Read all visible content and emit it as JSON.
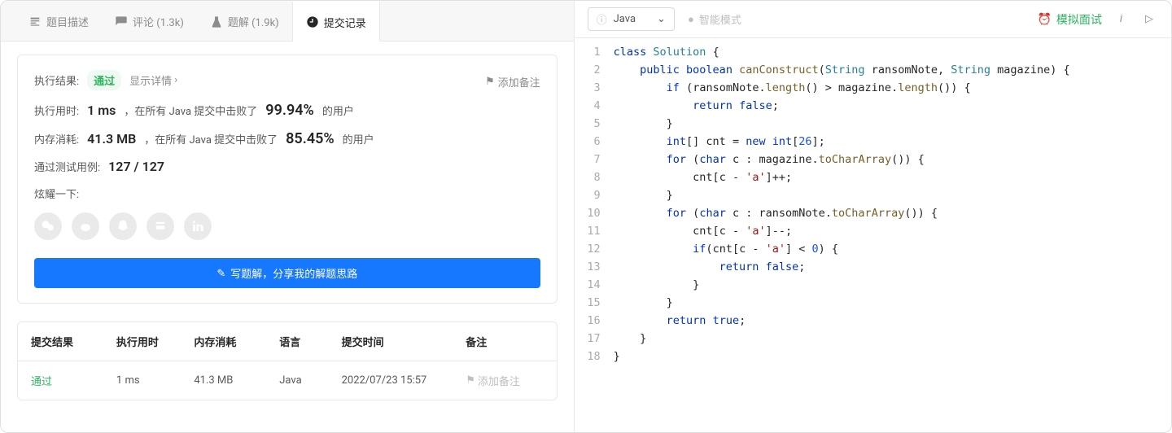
{
  "tabs": {
    "description": "题目描述",
    "comments": "评论 (1.3k)",
    "solutions": "题解 (1.9k)",
    "submissions": "提交记录"
  },
  "result": {
    "exec_label": "执行结果:",
    "status": "通过",
    "show_detail": "显示详情",
    "add_note": "添加备注",
    "runtime_label": "执行用时:",
    "runtime_value": "1 ms",
    "runtime_desc_prefix": "，在所有 Java 提交中击败了",
    "runtime_pct": "99.94%",
    "runtime_desc_suffix": "的用户",
    "memory_label": "内存消耗:",
    "memory_value": "41.3 MB",
    "memory_desc_prefix": "，在所有 Java 提交中击败了",
    "memory_pct": "85.45%",
    "memory_desc_suffix": "的用户",
    "testcases_label": "通过测试用例:",
    "testcases_value": "127 / 127",
    "share_label": "炫耀一下:",
    "write_solution": "写题解，分享我的解题思路"
  },
  "submissions_table": {
    "headers": {
      "result": "提交结果",
      "runtime": "执行用时",
      "memory": "内存消耗",
      "language": "语言",
      "time": "提交时间",
      "note": "备注"
    },
    "rows": [
      {
        "result": "通过",
        "runtime": "1 ms",
        "memory": "41.3 MB",
        "language": "Java",
        "time": "2022/07/23 15:57",
        "note": "添加备注"
      }
    ]
  },
  "editor_toolbar": {
    "language": "Java",
    "mode": "智能模式",
    "mock_interview": "模拟面试"
  },
  "code": {
    "lines": [
      [
        [
          "kw",
          "class"
        ],
        [
          "sp",
          " "
        ],
        [
          "type",
          "Solution"
        ],
        [
          "sp",
          " "
        ],
        [
          "punct",
          "{"
        ]
      ],
      [
        [
          "sp",
          "    "
        ],
        [
          "kw",
          "public"
        ],
        [
          "sp",
          " "
        ],
        [
          "kw",
          "boolean"
        ],
        [
          "sp",
          " "
        ],
        [
          "fn",
          "canConstruct"
        ],
        [
          "punct",
          "("
        ],
        [
          "type",
          "String"
        ],
        [
          "sp",
          " "
        ],
        [
          "ident",
          "ransomNote"
        ],
        [
          "punct",
          ", "
        ],
        [
          "type",
          "String"
        ],
        [
          "sp",
          " "
        ],
        [
          "ident",
          "magazine"
        ],
        [
          "punct",
          ") {"
        ]
      ],
      [
        [
          "sp",
          "        "
        ],
        [
          "kw",
          "if"
        ],
        [
          "sp",
          " "
        ],
        [
          "punct",
          "("
        ],
        [
          "ident",
          "ransomNote"
        ],
        [
          "punct",
          "."
        ],
        [
          "fn",
          "length"
        ],
        [
          "punct",
          "() > "
        ],
        [
          "ident",
          "magazine"
        ],
        [
          "punct",
          "."
        ],
        [
          "fn",
          "length"
        ],
        [
          "punct",
          "()) {"
        ]
      ],
      [
        [
          "sp",
          "            "
        ],
        [
          "kw",
          "return"
        ],
        [
          "sp",
          " "
        ],
        [
          "kw",
          "false"
        ],
        [
          "punct",
          ";"
        ]
      ],
      [
        [
          "sp",
          "        "
        ],
        [
          "punct",
          "}"
        ]
      ],
      [
        [
          "sp",
          "        "
        ],
        [
          "kw",
          "int"
        ],
        [
          "punct",
          "[] "
        ],
        [
          "ident",
          "cnt"
        ],
        [
          "punct",
          " = "
        ],
        [
          "kw",
          "new"
        ],
        [
          "sp",
          " "
        ],
        [
          "kw",
          "int"
        ],
        [
          "punct",
          "["
        ],
        [
          "num",
          "26"
        ],
        [
          "punct",
          "];"
        ]
      ],
      [
        [
          "sp",
          "        "
        ],
        [
          "kw",
          "for"
        ],
        [
          "sp",
          " "
        ],
        [
          "punct",
          "("
        ],
        [
          "kw",
          "char"
        ],
        [
          "sp",
          " "
        ],
        [
          "ident",
          "c"
        ],
        [
          "punct",
          " : "
        ],
        [
          "ident",
          "magazine"
        ],
        [
          "punct",
          "."
        ],
        [
          "fn",
          "toCharArray"
        ],
        [
          "punct",
          "()) {"
        ]
      ],
      [
        [
          "sp",
          "            "
        ],
        [
          "ident",
          "cnt"
        ],
        [
          "punct",
          "["
        ],
        [
          "ident",
          "c"
        ],
        [
          "punct",
          " - "
        ],
        [
          "str",
          "'a'"
        ],
        [
          "punct",
          "]++;"
        ]
      ],
      [
        [
          "sp",
          "        "
        ],
        [
          "punct",
          "}"
        ]
      ],
      [
        [
          "sp",
          "        "
        ],
        [
          "kw",
          "for"
        ],
        [
          "sp",
          " "
        ],
        [
          "punct",
          "("
        ],
        [
          "kw",
          "char"
        ],
        [
          "sp",
          " "
        ],
        [
          "ident",
          "c"
        ],
        [
          "punct",
          " : "
        ],
        [
          "ident",
          "ransomNote"
        ],
        [
          "punct",
          "."
        ],
        [
          "fn",
          "toCharArray"
        ],
        [
          "punct",
          "()) {"
        ]
      ],
      [
        [
          "sp",
          "            "
        ],
        [
          "ident",
          "cnt"
        ],
        [
          "punct",
          "["
        ],
        [
          "ident",
          "c"
        ],
        [
          "punct",
          " - "
        ],
        [
          "str",
          "'a'"
        ],
        [
          "punct",
          "]--;"
        ]
      ],
      [
        [
          "sp",
          "            "
        ],
        [
          "kw",
          "if"
        ],
        [
          "punct",
          "("
        ],
        [
          "ident",
          "cnt"
        ],
        [
          "punct",
          "["
        ],
        [
          "ident",
          "c"
        ],
        [
          "punct",
          " - "
        ],
        [
          "str",
          "'a'"
        ],
        [
          "punct",
          "] < "
        ],
        [
          "num",
          "0"
        ],
        [
          "punct",
          ") {"
        ]
      ],
      [
        [
          "sp",
          "                "
        ],
        [
          "kw",
          "return"
        ],
        [
          "sp",
          " "
        ],
        [
          "kw",
          "false"
        ],
        [
          "punct",
          ";"
        ]
      ],
      [
        [
          "sp",
          "            "
        ],
        [
          "punct",
          "}"
        ]
      ],
      [
        [
          "sp",
          "        "
        ],
        [
          "punct",
          "}"
        ]
      ],
      [
        [
          "sp",
          "        "
        ],
        [
          "kw",
          "return"
        ],
        [
          "sp",
          " "
        ],
        [
          "kw",
          "true"
        ],
        [
          "punct",
          ";"
        ]
      ],
      [
        [
          "sp",
          "    "
        ],
        [
          "punct",
          "}"
        ]
      ],
      [
        [
          "punct",
          "}"
        ]
      ]
    ]
  }
}
